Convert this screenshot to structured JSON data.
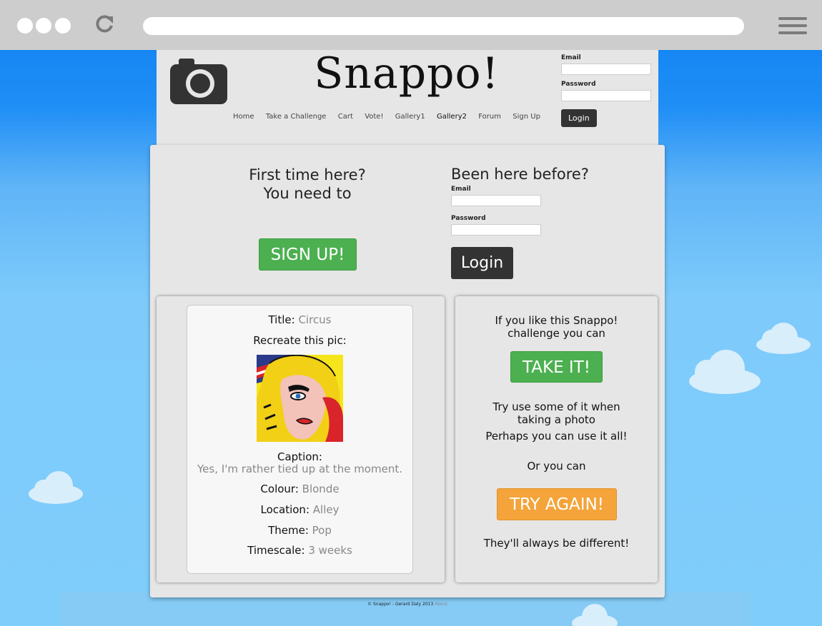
{
  "site": {
    "title": "Snappo!",
    "nav": [
      "Home",
      "Take a Challenge",
      "Cart",
      "Vote!",
      "Gallery1",
      "Gallery2",
      "Forum",
      "Sign Up"
    ],
    "active_nav": "Gallery2"
  },
  "header_login": {
    "email_label": "Email",
    "email_value": "",
    "password_label": "Password",
    "password_value": "",
    "button": "Login"
  },
  "signup": {
    "line1": "First time here?",
    "line2": "You need to",
    "button": "SIGN UP!"
  },
  "returning": {
    "heading": "Been here before?",
    "email_label": "Email",
    "password_label": "Password",
    "button": "Login"
  },
  "challenge": {
    "title_label": "Title:",
    "title_value": "Circus",
    "recreate_label": "Recreate this pic:",
    "caption_label": "Caption:",
    "caption_value": "Yes, I'm rather tied up at the moment.",
    "colour_label": "Colour:",
    "colour_value": "Blonde",
    "location_label": "Location:",
    "location_value": "Alley",
    "theme_label": "Theme:",
    "theme_value": "Pop",
    "timescale_label": "Timescale:",
    "timescale_value": "3 weeks"
  },
  "actions": {
    "like_line1": "If you like this Snappo!",
    "like_line2": "challenge you can",
    "take_button": "TAKE IT!",
    "try_line1": "Try use some of it when",
    "try_line2": "taking a photo",
    "try_line3": "Perhaps you can use it all!",
    "or_text": "Or you can",
    "again_button": "TRY AGAIN!",
    "always_text": "They'll always be different!"
  },
  "footer": {
    "copyright": "© Snappo! - Gerard Daly 2013",
    "about": "About"
  },
  "colors": {
    "green": "#4cb050",
    "orange": "#f4a43a",
    "dark_button": "#333333",
    "panel": "#e6e6e6"
  }
}
